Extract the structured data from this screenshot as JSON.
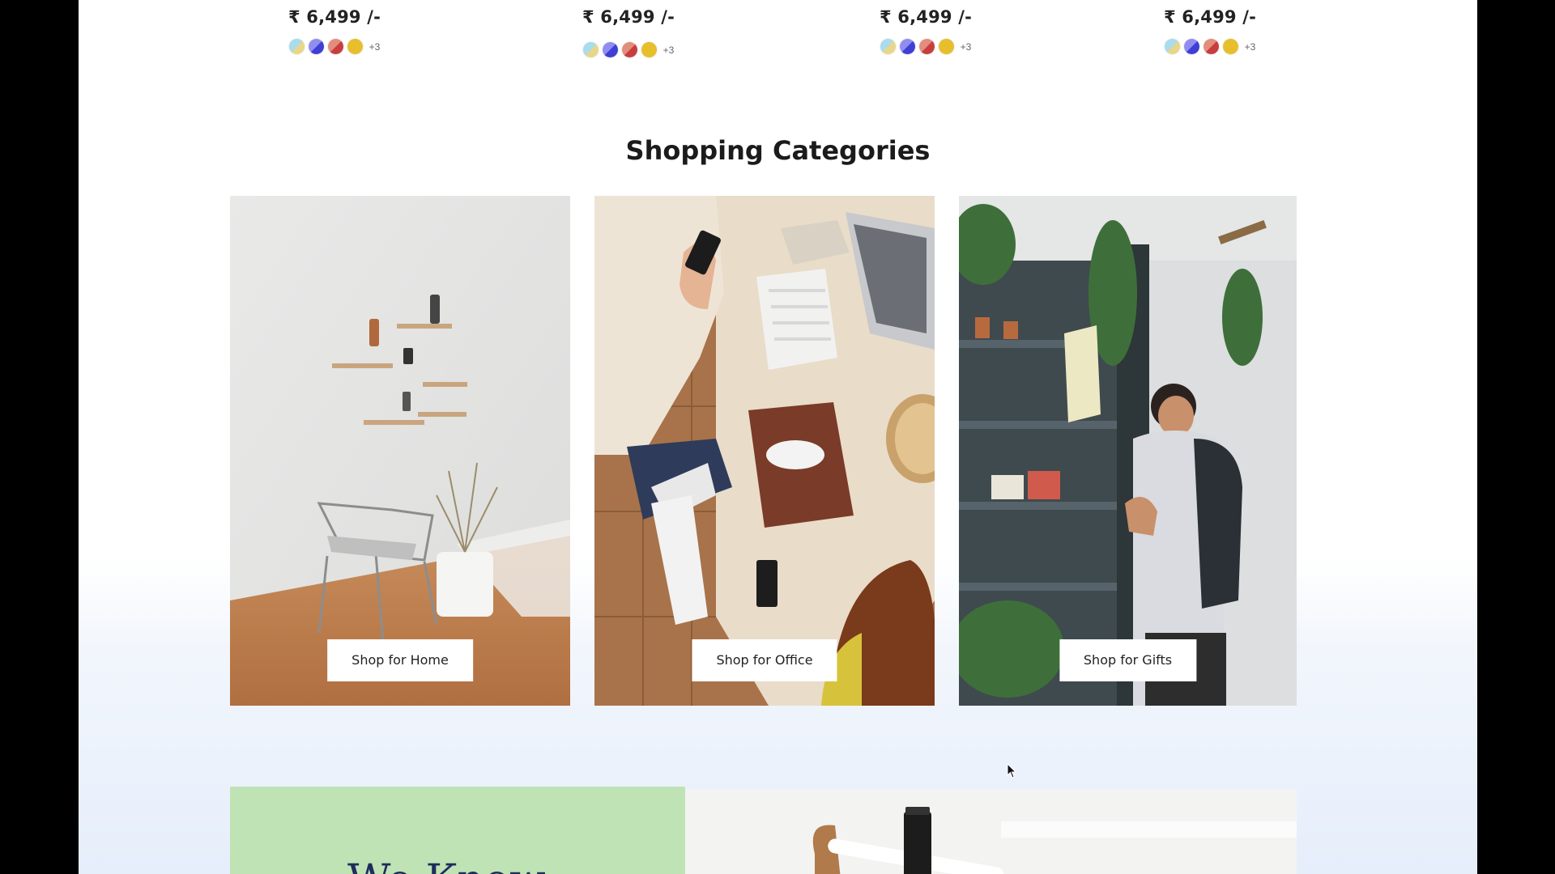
{
  "products": [
    {
      "price": "₹ 6,499 /-",
      "more": "+3"
    },
    {
      "price": "₹ 6,499 /-",
      "more": "+3"
    },
    {
      "price": "₹ 6,499 /-",
      "more": "+3"
    },
    {
      "price": "₹ 6,499 /-",
      "more": "+3"
    }
  ],
  "swatch_colors": [
    "#a9dcec",
    "#5b5be3",
    "#d0544f",
    "#e7be2c"
  ],
  "section": {
    "title_light": "Shopping",
    "title_bold": "Categories"
  },
  "categories": [
    {
      "label": "Shop for Home"
    },
    {
      "label": "Shop for Office"
    },
    {
      "label": "Shop for Gifts"
    }
  ],
  "banner": {
    "title": "We Know"
  }
}
